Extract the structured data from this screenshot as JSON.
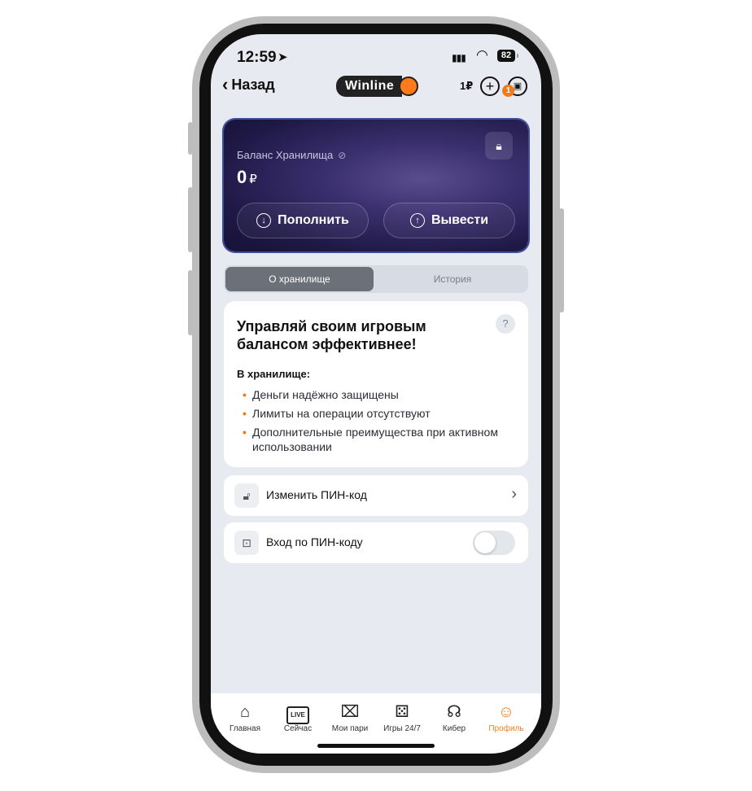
{
  "status_bar": {
    "time": "12:59",
    "battery": "82"
  },
  "nav": {
    "back_label": "Назад",
    "logo_text": "Winline",
    "balance": "1₽",
    "notification_count": "1"
  },
  "vault_card": {
    "label": "Баланс Хранилища",
    "amount": "0",
    "currency": "₽",
    "deposit_label": "Пополнить",
    "withdraw_label": "Вывести"
  },
  "tabs": [
    {
      "label": "О хранилище",
      "active": true
    },
    {
      "label": "История",
      "active": false
    }
  ],
  "info": {
    "heading": "Управляй своим игровым балансом эффективнее!",
    "subheading": "В хранилище:",
    "bullets": [
      "Деньги надёжно защищены",
      "Лимиты на операции отсутствуют",
      "Дополнительные преимущества при активном использовании"
    ],
    "help_symbol": "?"
  },
  "settings": {
    "change_pin": "Изменить ПИН-код",
    "pin_login": "Вход по ПИН-коду",
    "pin_login_enabled": false
  },
  "tabbar": [
    {
      "label": "Главная",
      "icon": "home-icon"
    },
    {
      "label": "Сейчас",
      "icon": "live-icon",
      "badge_text": "LIVE"
    },
    {
      "label": "Мои пари",
      "icon": "ticket-icon"
    },
    {
      "label": "Игры 24/7",
      "icon": "dice-icon"
    },
    {
      "label": "Кибер",
      "icon": "gamepad-icon"
    },
    {
      "label": "Профиль",
      "icon": "profile-icon",
      "active": true
    }
  ],
  "colors": {
    "accent": "#F07A1C",
    "card_bg": "#2A2358",
    "screen_bg": "#E7EBF1"
  }
}
